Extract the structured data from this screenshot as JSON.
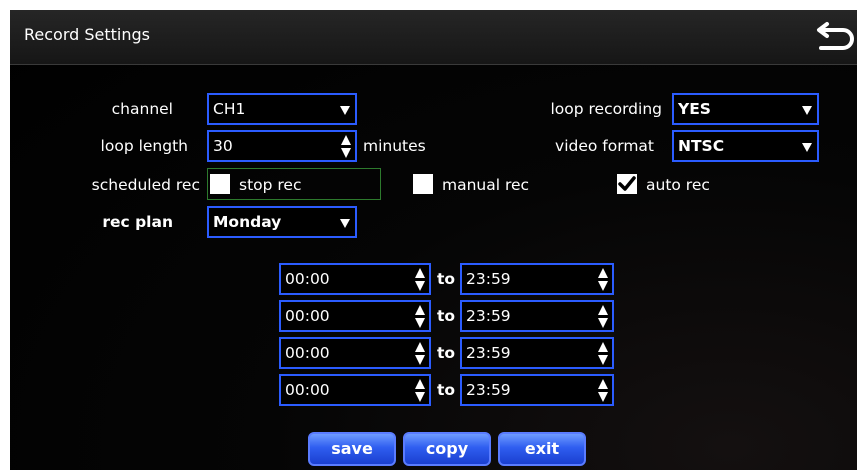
{
  "window": {
    "title": "Record Settings",
    "back_icon": "return-arrow-icon"
  },
  "form": {
    "channel_label": "channel",
    "channel_value": "CH1",
    "loop_length_label": "loop length",
    "loop_length_value": "30",
    "loop_length_unit": "minutes",
    "loop_recording_label": "loop recording",
    "loop_recording_value": "YES",
    "video_format_label": "video format",
    "video_format_value": "NTSC",
    "scheduled_rec_label": "scheduled rec",
    "stop_rec_label": "stop rec",
    "stop_rec_checked": false,
    "manual_rec_label": "manual rec",
    "manual_rec_checked": false,
    "auto_rec_label": "auto rec",
    "auto_rec_checked": true,
    "rec_plan_label": "rec plan",
    "rec_plan_value": "Monday"
  },
  "schedule": {
    "to_label": "to",
    "slots": [
      {
        "start": "00:00",
        "end": "23:59"
      },
      {
        "start": "00:00",
        "end": "23:59"
      },
      {
        "start": "00:00",
        "end": "23:59"
      },
      {
        "start": "00:00",
        "end": "23:59"
      }
    ]
  },
  "buttons": {
    "save": "save",
    "copy": "copy",
    "exit": "exit"
  }
}
